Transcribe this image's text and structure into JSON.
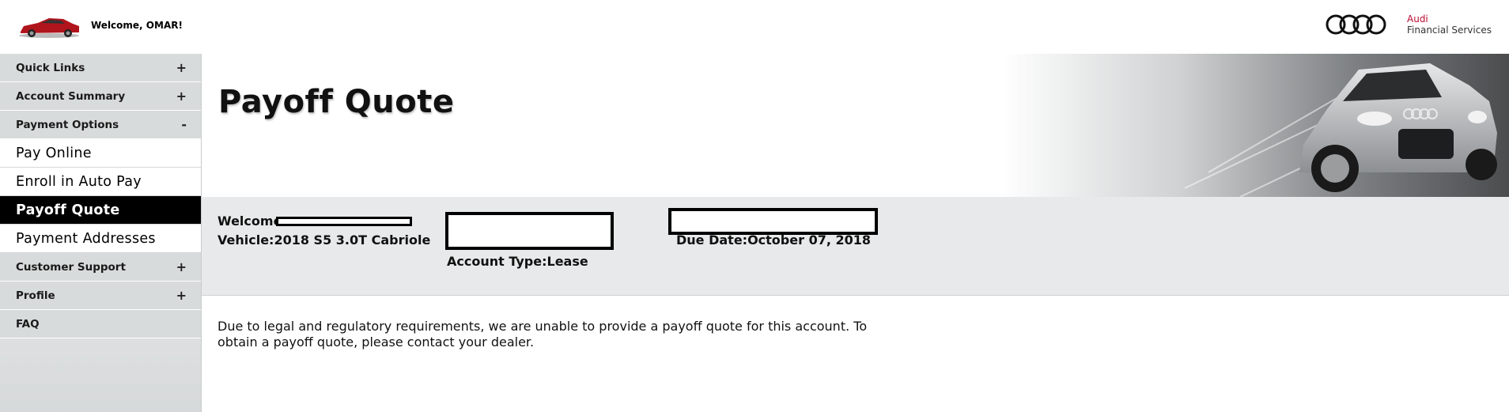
{
  "header": {
    "welcome": "Welcome, OMAR!",
    "brand_name": "Audi",
    "brand_sub": "Financial Services"
  },
  "sidebar": {
    "items": [
      {
        "label": "Quick Links",
        "toggle": "+"
      },
      {
        "label": "Account Summary",
        "toggle": "+"
      },
      {
        "label": "Payment Options",
        "toggle": "-"
      },
      {
        "label": "Pay Online"
      },
      {
        "label": "Enroll in Auto Pay"
      },
      {
        "label": "Payoff Quote"
      },
      {
        "label": "Payment Addresses"
      },
      {
        "label": "Customer Support",
        "toggle": "+"
      },
      {
        "label": "Profile",
        "toggle": "+"
      },
      {
        "label": "FAQ"
      }
    ]
  },
  "main": {
    "title": "Payoff Quote",
    "account": {
      "welcome_label": "Welcome:",
      "vehicle": "Vehicle:2018 S5 3.0T Cabriole",
      "account_type": "Account Type:Lease",
      "due_date": "Due Date:October 07, 2018"
    },
    "notice": "Due to legal and regulatory requirements, we are unable to provide a payoff quote for this account. To obtain a payoff quote, please contact your dealer."
  },
  "colors": {
    "accent_red": "#bb0a30",
    "active_nav": "#000000",
    "panel_gray": "#e8e9ea",
    "nav_gray": "#d8dbdb"
  },
  "icons": [
    "red-car-thumbnail-icon",
    "audi-rings-icon",
    "expand-plus-icon",
    "collapse-minus-icon",
    "silver-car-banner-image"
  ]
}
